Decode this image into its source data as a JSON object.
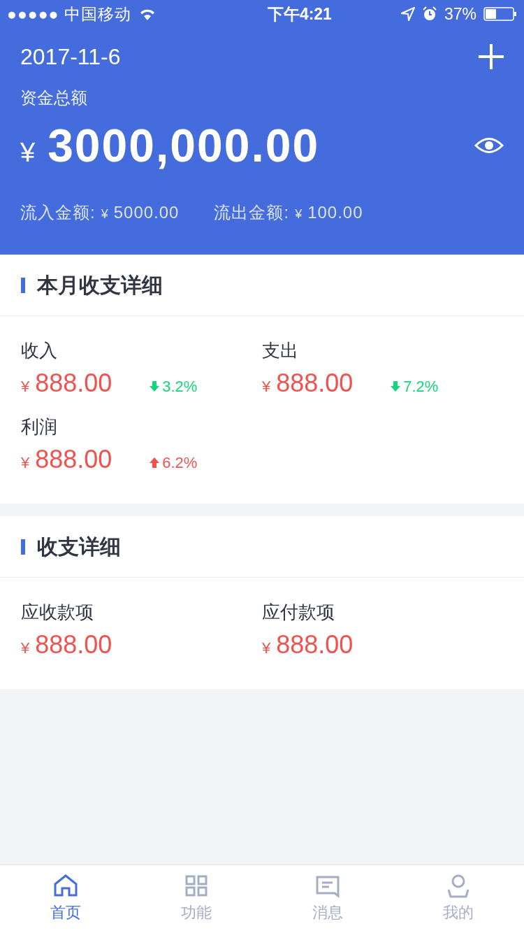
{
  "status_bar": {
    "carrier": "●●●●● 中国移动",
    "time": "下午4:21",
    "battery": "37%"
  },
  "header": {
    "date": "2017-11-6",
    "total_label": "资金总额",
    "currency": "¥",
    "total": "3000,000.00",
    "inflow_label": "流入金额:",
    "inflow_currency": "¥",
    "inflow": "5000.00",
    "outflow_label": "流出金额:",
    "outflow_currency": "¥",
    "outflow": "100.00"
  },
  "sections": [
    {
      "title": "本月收支详细",
      "items": [
        {
          "label": "收入",
          "currency": "¥",
          "amount": "888.00",
          "trend": {
            "kind": "down",
            "value": "3.2%"
          }
        },
        {
          "label": "支出",
          "currency": "¥",
          "amount": "888.00",
          "trend": {
            "kind": "down",
            "value": "7.2%"
          }
        },
        {
          "label": "利润",
          "currency": "¥",
          "amount": "888.00",
          "trend": {
            "kind": "up",
            "value": "6.2%"
          }
        }
      ]
    },
    {
      "title": "收支详细",
      "items": [
        {
          "label": "应收款项",
          "currency": "¥",
          "amount": "888.00"
        },
        {
          "label": "应付款项",
          "currency": "¥",
          "amount": "888.00"
        }
      ]
    }
  ],
  "tabs": [
    {
      "kind": "home",
      "label": "首页",
      "selected": true
    },
    {
      "kind": "grid",
      "label": "功能",
      "selected": false
    },
    {
      "kind": "message",
      "label": "消息",
      "selected": false
    },
    {
      "kind": "user",
      "label": "我的",
      "selected": false
    }
  ]
}
